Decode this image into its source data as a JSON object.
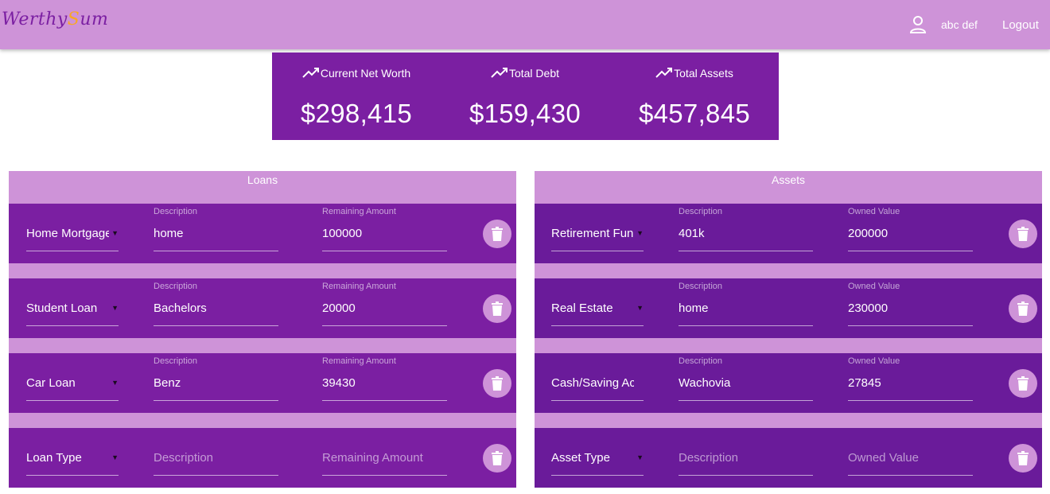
{
  "header": {
    "logo_part1": "Werthy",
    "logo_accent": "S",
    "logo_part2": "um",
    "user_icon": "person-icon",
    "user_name": "abc def",
    "logout_label": "Logout"
  },
  "summary": {
    "net_worth_label": "Current Net Worth",
    "net_worth_value": "$298,415",
    "total_debt_label": "Total Debt",
    "total_debt_value": "$159,430",
    "total_assets_label": "Total Assets",
    "total_assets_value": "$457,845",
    "trend_icon": "trending-up-icon"
  },
  "loans": {
    "title": "Loans",
    "rows": [
      {
        "type": "Home Mortgage",
        "desc_label": "Description",
        "desc": "home",
        "amount_label": "Remaining Amount",
        "amount": "100000"
      },
      {
        "type": "Student Loan",
        "desc_label": "Description",
        "desc": "Bachelors",
        "amount_label": "Remaining Amount",
        "amount": "20000"
      },
      {
        "type": "Car Loan",
        "desc_label": "Description",
        "desc": "Benz",
        "amount_label": "Remaining Amount",
        "amount": "39430"
      }
    ],
    "new_row": {
      "type": "Loan Type",
      "desc_placeholder": "Description",
      "amount_placeholder": "Remaining Amount"
    }
  },
  "assets": {
    "title": "Assets",
    "rows": [
      {
        "type": "Retirement Fund",
        "desc_label": "Description",
        "desc": "401k",
        "amount_label": "Owned Value",
        "amount": "200000"
      },
      {
        "type": "Real Estate",
        "desc_label": "Description",
        "desc": "home",
        "amount_label": "Owned Value",
        "amount": "230000"
      },
      {
        "type": "Cash/Saving Acco",
        "desc_label": "Description",
        "desc": "Wachovia",
        "amount_label": "Owned Value",
        "amount": "27845"
      }
    ],
    "new_row": {
      "type": "Asset Type",
      "desc_placeholder": "Description",
      "amount_placeholder": "Owned Value"
    }
  },
  "colors": {
    "header_bg": "#ce93d8",
    "primary": "#7b1fa2",
    "primary_dark": "#6a1b9a",
    "logo_accent": "#f9a825"
  }
}
